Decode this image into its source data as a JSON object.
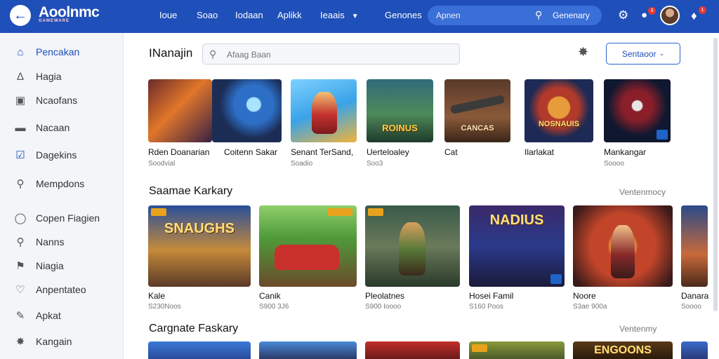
{
  "app": {
    "logo": "Aoolnmc",
    "logo_sub": "GAMEWARE"
  },
  "topbar": {
    "nav": [
      "Ioue",
      "Soao",
      "Iodaan",
      "Aplikk",
      "Ieaais",
      "Genones"
    ],
    "search_placeholder": "Apnen",
    "search_label": "Genenary",
    "badge_notif": "3",
    "badge_bell": "1"
  },
  "sidebar": {
    "items": [
      {
        "label": "Pencakan",
        "icon": "home-icon"
      },
      {
        "label": "Hagia",
        "icon": "house-outline-icon"
      },
      {
        "label": "Ncaofans",
        "icon": "square-icon"
      },
      {
        "label": "Nacaan",
        "icon": "dash-square-icon"
      },
      {
        "label": "Dagekins",
        "icon": "check-square-icon"
      },
      {
        "label": "Mempdons",
        "icon": "search-icon"
      },
      {
        "label": "Copen Fiagien",
        "icon": "circle-icon"
      },
      {
        "label": "Nanns",
        "icon": "pin-icon"
      },
      {
        "label": "Niagia",
        "icon": "bookmark-icon"
      },
      {
        "label": "Anpentateo",
        "icon": "heart-icon"
      },
      {
        "label": "Apkat",
        "icon": "edit-square-icon"
      },
      {
        "label": "Kangain",
        "icon": "puzzle-icon"
      }
    ]
  },
  "main": {
    "title": "INanajin",
    "search_placeholder": "Afaag Baan",
    "select_label": "Sentaoor"
  },
  "row1": [
    {
      "title": "Rden Doanarian",
      "sub": "Soodvial",
      "art": ""
    },
    {
      "title": "Coitenn Sakar",
      "sub": "",
      "art": ""
    },
    {
      "title": "Senant TerSand,",
      "sub": "Soadio",
      "art": ""
    },
    {
      "title": "Uerteloaley",
      "sub": "Soo3",
      "art": "ROINUS"
    },
    {
      "title": "Cat",
      "sub": "",
      "art": "CANCAS"
    },
    {
      "title": "Ilarlakat",
      "sub": "",
      "art": "NOSNAUIS"
    },
    {
      "title": "Mankangar",
      "sub": "Soooo",
      "art": ""
    }
  ],
  "section2": {
    "title": "Saamae Karkary",
    "link": "Ventenmocy"
  },
  "row2": [
    {
      "title": "Kale",
      "sub": "S230Noos",
      "art": "SNAUGHS"
    },
    {
      "title": "Canik",
      "sub": "S900 3J6",
      "art": ""
    },
    {
      "title": "Pleolatnes",
      "sub": "S900 Ioooo",
      "art": ""
    },
    {
      "title": "Hosei Famil",
      "sub": "S160 Poos",
      "art": "NADIUS"
    },
    {
      "title": "Noore",
      "sub": "S3ae 900a",
      "art": ""
    },
    {
      "title": "Danara",
      "sub": "Soooo",
      "art": ""
    }
  ],
  "section3": {
    "title": "Cargnate Faskary",
    "link": "Ventenmy"
  },
  "row3": [
    {
      "title": "",
      "art": ""
    },
    {
      "title": "",
      "art": ""
    },
    {
      "title": "",
      "art": ""
    },
    {
      "title": "",
      "art": ""
    },
    {
      "title": "",
      "art": ""
    },
    {
      "title": "",
      "art": "ENGOONS"
    },
    {
      "title": "",
      "art": ""
    }
  ]
}
